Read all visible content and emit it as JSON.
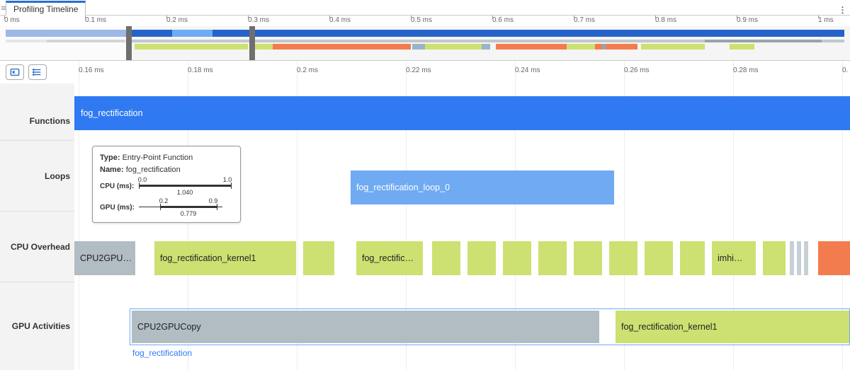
{
  "tab_title": "Profiling Timeline",
  "overview_ticks": [
    "0 ms",
    "0.1 ms",
    "0.2 ms",
    "0.3 ms",
    "0.4 ms",
    "0.5 ms",
    "0.6 ms",
    "0.7 ms",
    "0.8 ms",
    "0.9 ms",
    "1 ms"
  ],
  "viewport_ticks": [
    "0.16 ms",
    "0.18 ms",
    "0.2 ms",
    "0.22 ms",
    "0.24 ms",
    "0.26 ms",
    "0.28 ms",
    "0."
  ],
  "row_labels": {
    "functions": "Functions",
    "loops": "Loops",
    "cpu": "CPU Overhead",
    "gpu": "GPU Activities"
  },
  "bars": {
    "function": "fog_rectification",
    "loop": "fog_rectification_loop_0",
    "cpu_copy": "CPU2GPU…",
    "cpu_k1": "fog_rectification_kernel1",
    "cpu_k2": "fog_rectific…",
    "cpu_imhi": "imhi…",
    "gpu_copy": "CPU2GPUCopy",
    "gpu_k1": "fog_rectification_kernel1",
    "gpu_caption": "fog_rectification"
  },
  "tooltip": {
    "type_label": "Type:",
    "type_value": "Entry-Point Function",
    "name_label": "Name:",
    "name_value": "fog_rectification",
    "cpu_label": "CPU (ms):",
    "cpu_min": "0.0",
    "cpu_max": "1.0",
    "cpu_val": "1.040",
    "gpu_label": "GPU (ms):",
    "gpu_min": "0.2",
    "gpu_max": "0.9",
    "gpu_val": "0.779"
  },
  "chart_data": {
    "type": "timeline",
    "title": "Profiling Timeline",
    "x_unit": "ms",
    "overview_range": [
      0,
      1.04
    ],
    "viewport_range": [
      0.15,
      0.3
    ],
    "selection": [
      0.15,
      0.3
    ],
    "lanes": [
      {
        "name": "Functions",
        "events": [
          {
            "label": "fog_rectification",
            "start": 0.15,
            "end": 0.3,
            "extends_right": true,
            "color": "#2f7af3"
          }
        ]
      },
      {
        "name": "Loops",
        "events": [
          {
            "label": "fog_rectification_loop_0",
            "start": 0.2045,
            "end": 0.2535,
            "color": "#6faaf2"
          }
        ]
      },
      {
        "name": "CPU Overhead",
        "events": [
          {
            "label": "CPU2GPU…",
            "start": 0.15,
            "end": 0.1612,
            "color": "#b2bcc3"
          },
          {
            "label": "fog_rectification_kernel1",
            "start": 0.166,
            "end": 0.1938,
            "color": "#cce171"
          },
          {
            "label": "",
            "start": 0.1952,
            "end": 0.2018,
            "color": "#cce171"
          },
          {
            "label": "fog_rectific…",
            "start": 0.2055,
            "end": 0.2175,
            "color": "#cce171"
          },
          {
            "label": "",
            "start": 0.2198,
            "end": 0.225,
            "color": "#cce171"
          },
          {
            "label": "",
            "start": 0.2265,
            "end": 0.2325,
            "color": "#cce171"
          },
          {
            "label": "",
            "start": 0.234,
            "end": 0.2393,
            "color": "#cce171"
          },
          {
            "label": "",
            "start": 0.2408,
            "end": 0.246,
            "color": "#cce171"
          },
          {
            "label": "",
            "start": 0.2475,
            "end": 0.2528,
            "color": "#cce171"
          },
          {
            "label": "",
            "start": 0.2543,
            "end": 0.2595,
            "color": "#cce171"
          },
          {
            "label": "",
            "start": 0.261,
            "end": 0.2663,
            "color": "#cce171"
          },
          {
            "label": "",
            "start": 0.2678,
            "end": 0.273,
            "color": "#cce171"
          },
          {
            "label": "",
            "start": 0.2745,
            "end": 0.279,
            "color": "#cce171"
          },
          {
            "label": "imhi…",
            "start": 0.2805,
            "end": 0.288,
            "color": "#cce171"
          },
          {
            "label": "",
            "start": 0.2895,
            "end": 0.2932,
            "color": "#cce171"
          },
          {
            "label": "",
            "start": 0.294,
            "end": 0.2948,
            "color": "#c7d0d6"
          },
          {
            "label": "",
            "start": 0.2951,
            "end": 0.2959,
            "color": "#c7d0d6"
          },
          {
            "label": "",
            "start": 0.2962,
            "end": 0.297,
            "color": "#c7d0d6"
          },
          {
            "label": "",
            "start": 0.2978,
            "end": 0.3,
            "color": "#f37c4f"
          }
        ]
      },
      {
        "name": "GPU Activities",
        "container": {
          "start": 0.1605,
          "end": 0.3,
          "label": "fog_rectification"
        },
        "events": [
          {
            "label": "CPU2GPUCopy",
            "start": 0.1612,
            "end": 0.2528,
            "color": "#b2bcc3"
          },
          {
            "label": "fog_rectification_kernel1",
            "start": 0.2558,
            "end": 0.3,
            "extends_right": true,
            "color": "#cce171"
          }
        ]
      }
    ],
    "tooltip_target": {
      "type": "Entry-Point Function",
      "name": "fog_rectification",
      "cpu_ms": {
        "min": 0.0,
        "max": 1.0,
        "value": 1.04
      },
      "gpu_ms": {
        "min": 0.2,
        "max": 0.9,
        "value": 0.779
      }
    },
    "overview_minimap": {
      "lane_blue": [
        {
          "start": 0.0,
          "end": 1.04,
          "color": "#2563c9"
        }
      ],
      "lane_blue_accents": [
        {
          "start": 0.204,
          "end": 0.254,
          "color": "#6faaf2"
        }
      ],
      "lane_grey": [
        {
          "start": 0.05,
          "end": 0.15,
          "color": "#9aa3a9"
        },
        {
          "start": 0.86,
          "end": 1.0,
          "color": "#9aa3a9"
        }
      ],
      "lane_mix": [
        {
          "start": 0.16,
          "end": 0.3,
          "color": "#cce171"
        },
        {
          "start": 0.3,
          "end": 0.5,
          "color": "#cce171"
        },
        {
          "start": 0.32,
          "end": 0.5,
          "color": "#f37c4f"
        },
        {
          "start": 0.5,
          "end": 0.6,
          "color": "#9bb3c6"
        },
        {
          "start": 0.6,
          "end": 0.78,
          "color": "#f37c4f"
        },
        {
          "start": 0.63,
          "end": 0.68,
          "color": "#cce171"
        },
        {
          "start": 0.78,
          "end": 0.86,
          "color": "#cce171"
        },
        {
          "start": 0.89,
          "end": 0.92,
          "color": "#cce171"
        }
      ]
    }
  }
}
